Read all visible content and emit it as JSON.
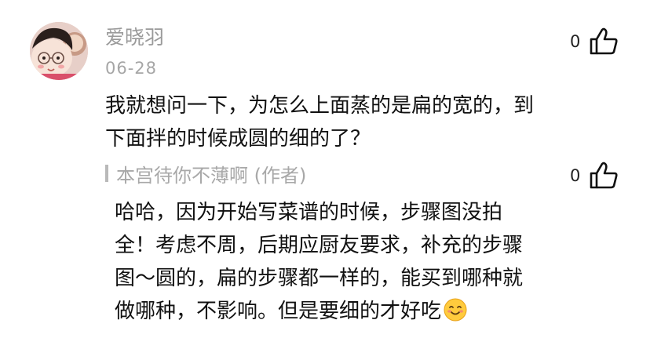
{
  "comment": {
    "username": "爱晓羽",
    "date": "06-28",
    "likes": "0",
    "lines": [
      "我就想问一下，为怎么上面蒸的是扁的宽的，到",
      "下面拌的时候成圆的细的了？"
    ]
  },
  "reply": {
    "author": "本宫待你不薄啊 (作者)",
    "likes": "0",
    "lines": [
      "哈哈，因为开始写菜谱的时候，步骤图没拍",
      "全！考虑不周，后期应厨友要求，补充的步骤",
      "图～圆的，扁的步骤都一样的，能买到哪种就",
      "做哪种，不影响。但是要细的才好吃"
    ],
    "trailing_emoji": "smiling-face-emoji"
  },
  "colors": {
    "meta_gray": "#9a9a9a",
    "text": "#111111",
    "reply_bar": "#b9b9b9"
  }
}
